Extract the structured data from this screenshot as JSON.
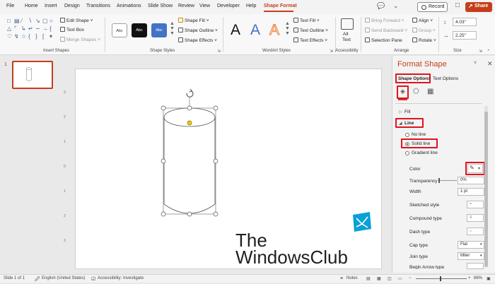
{
  "menubar": {
    "tabs": [
      "File",
      "Home",
      "Insert",
      "Design",
      "Transitions",
      "Animations",
      "Slide Show",
      "Review",
      "View",
      "Developer",
      "Help",
      "Shape Format"
    ],
    "active_tab": "Shape Format",
    "record_label": "Record",
    "share_label": "Share"
  },
  "ribbon": {
    "insert_shapes": {
      "edit_shape": "Edit Shape",
      "text_box": "Text Box",
      "merge_shapes": "Merge Shapes",
      "label": "Insert Shapes"
    },
    "shape_styles": {
      "style_samples": [
        "Abc",
        "Abc",
        "Abc"
      ],
      "shape_fill": "Shape Fill",
      "shape_outline": "Shape Outline",
      "shape_effects": "Shape Effects",
      "label": "Shape Styles"
    },
    "wordart": {
      "samples": [
        "A",
        "A",
        "A"
      ],
      "text_fill": "Text Fill",
      "text_outline": "Text Outline",
      "text_effects": "Text Effects",
      "label": "WordArt Styles"
    },
    "accessibility": {
      "alt_text_line1": "Alt",
      "alt_text_line2": "Text",
      "label": "Accessibility"
    },
    "arrange": {
      "bring_forward": "Bring Forward",
      "send_backward": "Send Backward",
      "selection_pane": "Selection Pane",
      "align": "Align",
      "group": "Group",
      "rotate": "Rotate",
      "label": "Arrange"
    },
    "size": {
      "height": "4.03\"",
      "width": "2.25\"",
      "label": "Size"
    }
  },
  "thumbnails": {
    "slide_number": "1"
  },
  "format_panel": {
    "title": "Format Shape",
    "tabs": {
      "shape_options": "Shape Options",
      "text_options": "Text Options"
    },
    "sections": {
      "fill": "Fill",
      "line": "Line"
    },
    "line_options": {
      "no_line": "No line",
      "solid_line": "Solid line",
      "gradient_line": "Gradient line"
    },
    "properties": {
      "color": "Color",
      "transparency": "Transparency",
      "transparency_value": "0%",
      "width": "Width",
      "width_value": "1 pt",
      "sketched_style": "Sketched style",
      "compound_type": "Compound type",
      "dash_type": "Dash type",
      "cap_type": "Cap type",
      "cap_value": "Flat",
      "join_type": "Join type",
      "join_value": "Miter",
      "begin_arrow_type": "Begin Arrow type"
    }
  },
  "watermark": {
    "line1": "The",
    "line2": "WindowsClub"
  },
  "statusbar": {
    "slide_info": "Slide 1 of 1",
    "language": "English (United States)",
    "accessibility": "Accessibility: Investigate",
    "notes": "Notes",
    "zoom": "66%"
  },
  "colors": {
    "accent": "#c43e1c",
    "highlight_box": "#e0131d",
    "selection_handle": "#f0c419"
  }
}
